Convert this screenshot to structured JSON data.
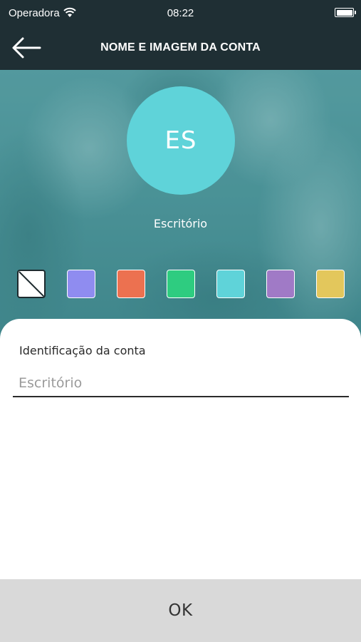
{
  "status_bar": {
    "carrier": "Operadora",
    "time": "08:22"
  },
  "nav": {
    "title": "NOME E IMAGEM DA CONTA",
    "back_icon": "arrow-left-icon"
  },
  "avatar": {
    "initials": "ES",
    "color": "#5fd3d9"
  },
  "account_name": "Escritório",
  "swatches": [
    {
      "name": "none",
      "color": "#ffffff"
    },
    {
      "name": "periwinkle",
      "color": "#8f8cf0"
    },
    {
      "name": "orange",
      "color": "#ec7150"
    },
    {
      "name": "green",
      "color": "#2ecc80"
    },
    {
      "name": "cyan",
      "color": "#5fd3d9"
    },
    {
      "name": "purple",
      "color": "#a07ac6"
    },
    {
      "name": "yellow",
      "color": "#e3c75c"
    }
  ],
  "form": {
    "label": "Identificação da conta",
    "placeholder": "Escritório",
    "value": ""
  },
  "ok_label": "OK",
  "colors": {
    "header_bg": "#1f2f34",
    "ok_bg": "#d9d9d9"
  }
}
